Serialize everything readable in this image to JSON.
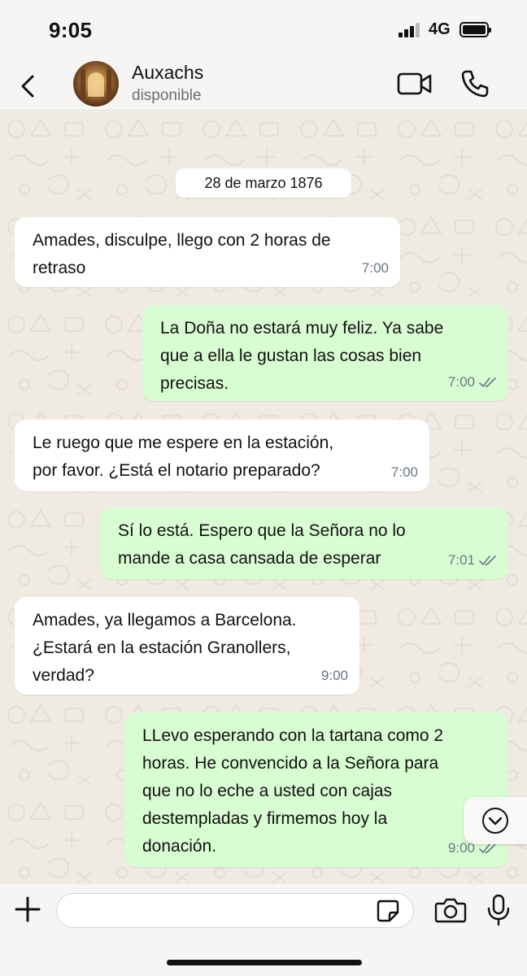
{
  "status_bar": {
    "time": "9:05",
    "network": "4G"
  },
  "header": {
    "contact_name": "Auxachs",
    "contact_status": "disponible"
  },
  "chat": {
    "date_chip": "28 de marzo 1876",
    "messages": [
      {
        "direction": "incoming",
        "text": "Amades, disculpe, llego con 2 horas de\nretraso",
        "time": "7:00"
      },
      {
        "direction": "outgoing",
        "text": "La Doña no estará muy feliz. Ya sabe\nque a ella le gustan las cosas bien\nprecisas.",
        "time": "7:00",
        "read_status": "double-check"
      },
      {
        "direction": "incoming",
        "text": "Le ruego que me espere en la estación,\npor favor. ¿Está el notario preparado?",
        "time": "7:00"
      },
      {
        "direction": "outgoing",
        "text": "Sí lo está. Espero que la Señora no lo\nmande a casa cansada de esperar",
        "time": "7:01",
        "read_status": "double-check"
      },
      {
        "direction": "incoming",
        "text": "Amades, ya llegamos a Barcelona.\n¿Estará en la estación Granollers,\nverdad?",
        "time": "9:00"
      },
      {
        "direction": "outgoing",
        "text": "LLevo esperando con la tartana como 2\nhoras. He convencido a la Señora para\nque no lo eche a usted con cajas\ndestempladas y firmemos hoy la\ndonación.",
        "time": "9:00",
        "read_status": "double-check"
      }
    ]
  },
  "input_bar": {
    "placeholder": ""
  },
  "colors": {
    "incoming_bubble": "#ffffff",
    "outgoing_bubble": "#d9fdd3",
    "chat_background": "#efeae2",
    "meta_text": "#667781"
  },
  "icons": [
    "chevron-left-icon",
    "video-camera-icon",
    "phone-icon",
    "chevron-down-circle-icon",
    "plus-icon",
    "sticker-icon",
    "camera-icon",
    "microphone-icon",
    "double-check-icon"
  ]
}
